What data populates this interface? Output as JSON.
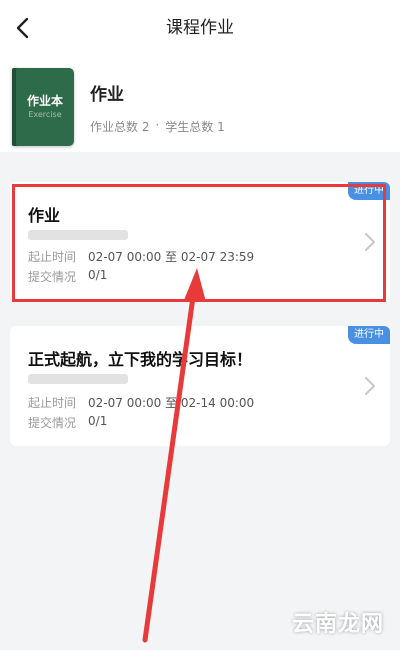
{
  "header": {
    "title": "课程作业"
  },
  "course": {
    "cover_title": "作业本",
    "cover_subtitle": "Exercise",
    "name": "作业",
    "stats_homework": "作业总数 2",
    "stats_sep": "·",
    "stats_students": "学生总数 1"
  },
  "assignments": [
    {
      "status": "进行中",
      "title": "作业",
      "time_label": "起止时间",
      "time_value": "02-07 00:00 至 02-07 23:59",
      "submit_label": "提交情况",
      "submit_value": "0/1"
    },
    {
      "status": "进行中",
      "title": "正式起航，立下我的学习目标！",
      "time_label": "起止时间",
      "time_value": "02-07 00:00 至 02-14 00:00",
      "submit_label": "提交情况",
      "submit_value": "0/1"
    }
  ],
  "watermark": "云南龙网",
  "colors": {
    "accent": "#4a90e2",
    "highlight": "#e83a3a",
    "cover": "#2e6b4a"
  }
}
